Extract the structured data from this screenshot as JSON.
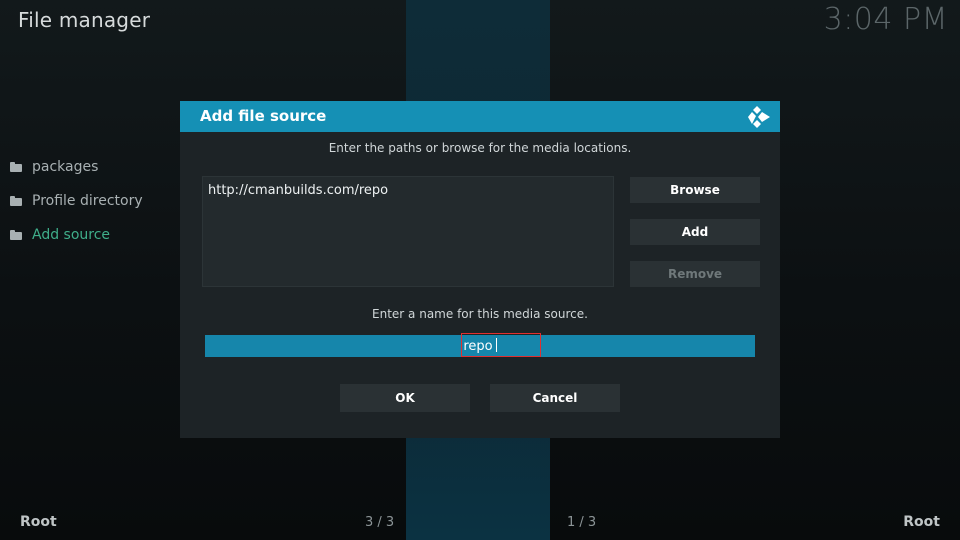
{
  "header": {
    "title": "File manager",
    "clock": "3:04 PM"
  },
  "sidebar": {
    "items": [
      {
        "label": "packages",
        "icon": "folder-icon"
      },
      {
        "label": "Profile directory",
        "icon": "folder-icon"
      },
      {
        "label": "Add source",
        "icon": "folder-icon",
        "active": true
      }
    ]
  },
  "dialog": {
    "title": "Add file source",
    "icon": "kodi-logo-icon",
    "instruction": "Enter the paths or browse for the media locations.",
    "paths": [
      "http://cmanbuilds.com/repo"
    ],
    "buttons": {
      "browse": "Browse",
      "add": "Add",
      "remove": "Remove"
    },
    "name_instruction": "Enter a name for this media source.",
    "name_value": "repo",
    "ok_label": "OK",
    "cancel_label": "Cancel"
  },
  "footer": {
    "left_label": "Root",
    "right_label": "Root",
    "left_count": "3 / 3",
    "right_count": "1 / 3"
  },
  "colors": {
    "accent": "#1590b5",
    "active_item": "#3fae8a",
    "highlight_border": "#e03030"
  }
}
